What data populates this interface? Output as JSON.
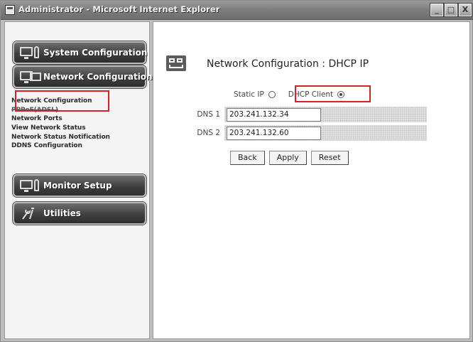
{
  "window": {
    "title": "Administrator - Microsoft Internet Explorer",
    "controls": [
      "_",
      "□",
      "X"
    ]
  },
  "sidebar": {
    "buttons": [
      {
        "label": "System Configuration",
        "icon": "monitor-key-icon"
      },
      {
        "label": "Network Configuration",
        "icon": "network-icon"
      },
      {
        "label": "Monitor Setup",
        "icon": "monitor-key-icon"
      },
      {
        "label": "Utilities",
        "icon": "tools-icon"
      }
    ],
    "links": [
      "Network Configuration",
      "PPPoE(ADSL)",
      "Network Ports",
      "View Network Status",
      "Network Status Notification",
      "DDNS Configuration"
    ]
  },
  "main": {
    "title": "Network Configuration : DHCP IP",
    "modes": [
      {
        "label": "Static IP",
        "checked": false
      },
      {
        "label": "DHCP Client",
        "checked": true
      }
    ],
    "dns": [
      {
        "label": "DNS 1",
        "value": "203.241.132.34"
      },
      {
        "label": "DNS 2",
        "value": "203.241.132.60"
      }
    ],
    "buttons": {
      "back": "Back",
      "apply": "Apply",
      "reset": "Reset"
    }
  },
  "colors": {
    "highlight": "#d2232a",
    "nav_button": "#3f3f3f"
  }
}
